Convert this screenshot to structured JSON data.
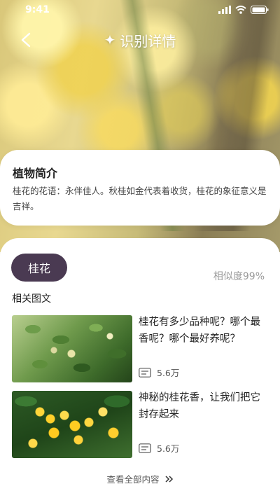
{
  "status_bar": {
    "time": "9:41"
  },
  "header": {
    "title": "识别详情",
    "title_icon": "sparkle-icon",
    "back_icon": "chevron-left-icon"
  },
  "intro": {
    "title": "植物简介",
    "text": "桂花的花语：永伴佳人。秋桂如金代表着收货，桂花的象征意义是吉祥。"
  },
  "result": {
    "name": "桂花",
    "similarity": "相似度99%",
    "related_label": "相关图文",
    "accent_color": "#4a3a52"
  },
  "articles": [
    {
      "title": "桂花有多少品种呢？哪个最香呢？哪个最好养呢？",
      "count": "5.6万",
      "icon": "comment-icon"
    },
    {
      "title": "神秘的桂花香，让我们把它封存起来",
      "count": "5.6万",
      "icon": "comment-icon"
    }
  ],
  "view_all": {
    "label": "查看全部内容",
    "icon": "double-chevron-right-icon"
  }
}
